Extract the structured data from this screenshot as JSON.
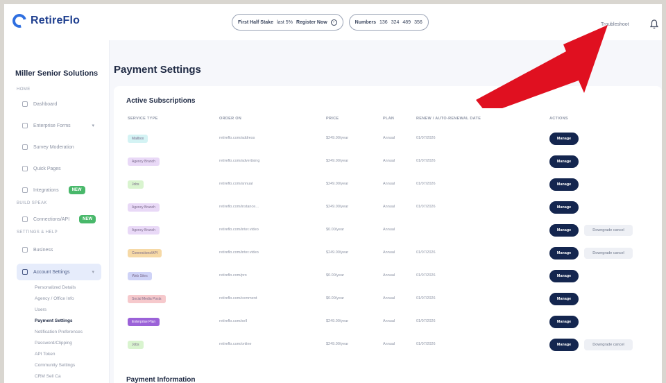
{
  "app": {
    "logo_text": "RetireFlo",
    "user_name": "Troubleshoot"
  },
  "topbar": {
    "pill_left": {
      "label": "First Half Stake",
      "value": "last 5%",
      "link": "Register Now"
    },
    "pill_right": {
      "label": "Numbers",
      "v1": "136",
      "v2": "324",
      "v3": "489",
      "v4": "356"
    }
  },
  "sidebar": {
    "org_name": "Miller Senior Solutions",
    "section_home": "HOME",
    "section_build": "BUILD SPEAK",
    "section_settings": "SETTINGS & HELP",
    "items": [
      {
        "label": "Dashboard"
      },
      {
        "label": "Enterprise Forms",
        "chevron": "▾"
      },
      {
        "label": "Survey Moderation"
      },
      {
        "label": "Quick Pages"
      },
      {
        "label": "Integrations",
        "badge": "NEW"
      },
      {
        "label": "Connections/API",
        "badge": "NEW"
      },
      {
        "label": "Business"
      },
      {
        "label": "Account Settings",
        "chevron": "▾"
      }
    ],
    "sub_items": [
      "Personalized Details",
      "Agency / Office Info",
      "Users",
      "Payment Settings",
      "Notification Preferences",
      "Password/Clipping",
      "API Token",
      "Community Settings",
      "CRM Sell Ca"
    ]
  },
  "main": {
    "page_title": "Payment Settings",
    "card_title": "Active Subscriptions",
    "headers": [
      "SERVICE TYPE",
      "ORDER ON",
      "PRICE",
      "PLAN",
      "RENEW / AUTO-RENEWAL DATE",
      "ACTIONS"
    ],
    "rows": [
      {
        "type": "Mailbox",
        "color": "#d4f3f4",
        "order": "retireflo.com/address",
        "price": "$249.00/year",
        "plan": "Annual",
        "date": "01/07/2026",
        "manage": "Manage",
        "downgrade": ""
      },
      {
        "type": "Agency Branch",
        "color": "#e9d9f7",
        "order": "retireflo.com/advertising",
        "price": "$249.00/year",
        "plan": "Annual",
        "date": "01/07/2026",
        "manage": "Manage",
        "downgrade": ""
      },
      {
        "type": "Jobs",
        "color": "#d9f4cf",
        "order": "retireflo.com/annual",
        "price": "$249.00/year",
        "plan": "Annual",
        "date": "01/07/2026",
        "manage": "Manage",
        "downgrade": ""
      },
      {
        "type": "Agency Branch",
        "color": "#e9d9f7",
        "order": "retireflo.com/instance...",
        "price": "$249.00/year",
        "plan": "Annual",
        "date": "01/07/2026",
        "manage": "Manage",
        "downgrade": ""
      },
      {
        "type": "Agency Branch",
        "color": "#e9d9f7",
        "order": "retireflo.com/inter.video",
        "price": "$0.00/year",
        "plan": "Annual",
        "date": "",
        "manage": "Manage",
        "downgrade": "Downgrade cancel"
      },
      {
        "type": "Connections/API",
        "color": "#f6d9a6",
        "order": "retireflo.com/inter.video",
        "price": "$249.00/year",
        "plan": "Annual",
        "date": "01/07/2026",
        "manage": "Manage",
        "downgrade": "Downgrade cancel"
      },
      {
        "type": "Web Sites",
        "color": "#cfd3f7",
        "order": "retireflo.com/pro",
        "price": "$0.00/year",
        "plan": "Annual",
        "date": "01/07/2026",
        "manage": "Manage",
        "downgrade": ""
      },
      {
        "type": "Social Media Posts",
        "color": "#f6c9cc",
        "order": "retireflo.com/comment",
        "price": "$0.00/year",
        "plan": "Annual",
        "date": "01/07/2026",
        "manage": "Manage",
        "downgrade": ""
      },
      {
        "type": "Enterprise Plan",
        "color": "#9b62d8",
        "order": "retireflo.com/sell",
        "price": "$249.00/year",
        "plan": "Annual",
        "date": "01/07/2026",
        "manage": "Manage",
        "downgrade": ""
      },
      {
        "type": "Jobs",
        "color": "#d9f4cf",
        "order": "retireflo.com/online",
        "price": "$249.00/year",
        "plan": "Annual",
        "date": "01/07/2026",
        "manage": "Manage",
        "downgrade": "Downgrade cancel"
      }
    ],
    "payment_info_title": "Payment Information"
  },
  "colors": {
    "accent": "#14264f",
    "annotation": "#e01020",
    "badge_green": "#48b86a"
  },
  "icons": {
    "notification": "bell-icon",
    "annotation": "red-arrow-icon"
  }
}
